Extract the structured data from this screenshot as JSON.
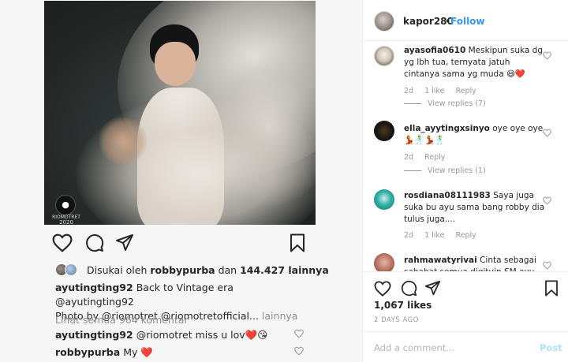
{
  "post": {
    "badge_label": "RIOMOTRET",
    "badge_year": "2020",
    "liked_by_prefix": "Disukai oleh",
    "liked_by_user": "robbypurba",
    "liked_by_conj": "dan",
    "liked_by_count": "144.427 lainnya",
    "caption_user": "ayutingting92",
    "caption_text": "Back to Vintage era @ayutingting92",
    "caption_line2": "Photo by @riomotret @riomotretofficial...",
    "caption_more": "lainnya",
    "view_all_comments": "Lihat semua 964 komentar",
    "comments": [
      {
        "user": "ayutingting92",
        "text": "@riomotret miss u lov❤️😘"
      },
      {
        "user": "robbypurba",
        "text": "My ❤️"
      }
    ]
  },
  "panel": {
    "username": "kapor280",
    "dot": "•",
    "follow": "Follow",
    "comments": [
      {
        "user": "ayasofia0610",
        "text": "Meskipun suka dg yg lbh tua, ternyata jatuh cintanya sama yg muda 😄❤️",
        "time": "2d",
        "likes": "1 like",
        "reply": "Reply",
        "view_replies": "View replies (7)"
      },
      {
        "user": "ella_ayytingxsinyo",
        "text": "oye oye oye💃🕺💃🕺",
        "time": "2d",
        "likes": "",
        "reply": "Reply",
        "view_replies": "View replies (1)"
      },
      {
        "user": "rosdiana08111983",
        "text": "Saya juga suka bu ayu sama bang robby dia tulus juga....",
        "time": "2d",
        "likes": "1 like",
        "reply": "Reply",
        "view_replies": ""
      },
      {
        "user": "rahmawatyrivai",
        "text": "Cinta sebagai sahabat semua digituin SM ayu...",
        "time": "",
        "likes": "",
        "reply": "",
        "view_replies": ""
      }
    ],
    "likes": "1,067 likes",
    "timestamp": "2 DAYS AGO",
    "add_comment_placeholder": "Add a comment...",
    "post_button": "Post"
  },
  "colors": {
    "link": "#3897f0",
    "post_disabled": "#b2dffc",
    "heart": "#ed4956"
  }
}
